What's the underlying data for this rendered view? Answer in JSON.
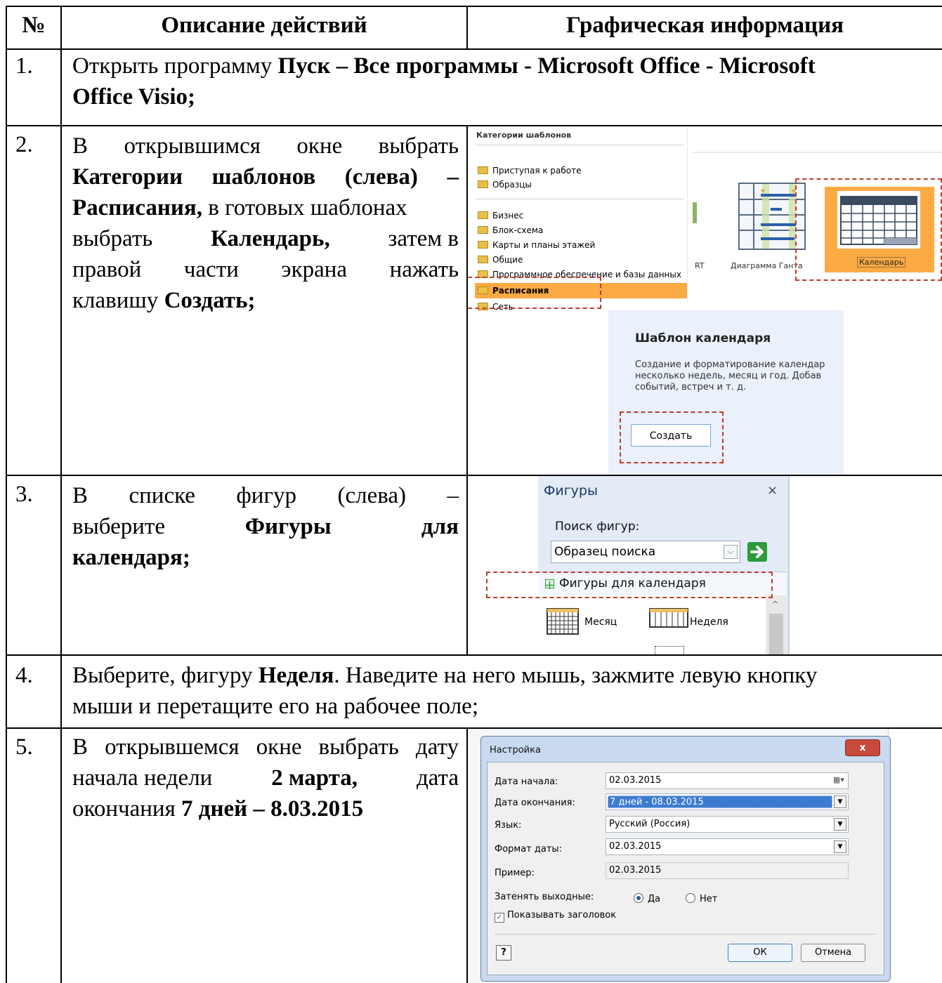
{
  "header": {
    "num": "№",
    "desc": "Описание действий",
    "graph": "Графическая информация"
  },
  "rows": [
    {
      "num": "1.",
      "text_a": "Открыть программу ",
      "bold_a": "Пуск – Все программы - Microsoft Office - Microsoft",
      "bold_b": "Office Visio;"
    },
    {
      "num": "2.",
      "l1": "В открывшимся окне выбрать",
      "l2": "Категории шаблонов (слева) –",
      "l3b": "Расписания,",
      "l3": " в готовых шаблонах",
      "l4a": "выбрать ",
      "l4b": "Календарь,",
      "l4c": " затем в",
      "l5": "правой части экрана нажать",
      "l6a": "клавишу ",
      "l6b": "Создать;"
    },
    {
      "num": "3.",
      "l1": "В списке фигур (слева) –",
      "l2a": "выберите ",
      "l2b": "Фигуры для",
      "l3b": "календаря;"
    },
    {
      "num": "4.",
      "l1a": "Выберите, фигуру ",
      "l1b": "Неделя",
      "l1c": ". Наведите на него мышь, зажмите левую кнопку",
      "l2": "мыши и перетащите его на рабочее поле;"
    },
    {
      "num": "5.",
      "l1": "В открывшемся окне выбрать дату",
      "l2a": "начала недели ",
      "l2b": "2 марта,",
      "l2c": " дата",
      "l3a": "окончания ",
      "l3b": "7 дней – 8.03.2015"
    }
  ],
  "visio_templates": {
    "panel_title": "Категории шаблонов",
    "categories": [
      "Приступая к работе",
      "Образцы",
      "Бизнес",
      "Блок-схема",
      "Карты и планы этажей",
      "Общие",
      "Программное обеспечение и базы данных",
      "Расписания",
      "Сеть"
    ],
    "thumb_partial": "RT",
    "thumb_gantt": "Диаграмма Ганта",
    "thumb_calendar": "Календарь",
    "detail_title": "Шаблон календаря",
    "detail_desc": [
      "Создание и форматирование календар",
      "несколько недель, месяц и год. Добав",
      "событий, встреч и т. д."
    ],
    "create_button": "Создать"
  },
  "shapes_panel": {
    "title": "Фигуры",
    "search_label": "Поиск фигур:",
    "search_value": "Образец поиска",
    "stencil": "Фигуры для календаря",
    "shape_month": "Месяц",
    "shape_week": "Неделя"
  },
  "settings_dialog": {
    "title": "Настройка",
    "start_label": "Дата начала:",
    "start_value": "02.03.2015",
    "end_label": "Дата окончания:",
    "end_value": "7 дней - 08.03.2015",
    "lang_label": "Язык:",
    "lang_value": "Русский (Россия)",
    "fmt_label": "Формат даты:",
    "fmt_value": "02.03.2015",
    "sample_label": "Пример:",
    "sample_value": "02.03.2015",
    "shade_label": "Затенять выходные:",
    "yes": "Да",
    "no": "Нет",
    "show_header": "Показывать заголовок",
    "ok": "ОК",
    "cancel": "Отмена"
  },
  "colors": {
    "accent_orange": "#fbaa44",
    "dash_red": "#c0392b",
    "button_blue": "#3d7bd0"
  }
}
